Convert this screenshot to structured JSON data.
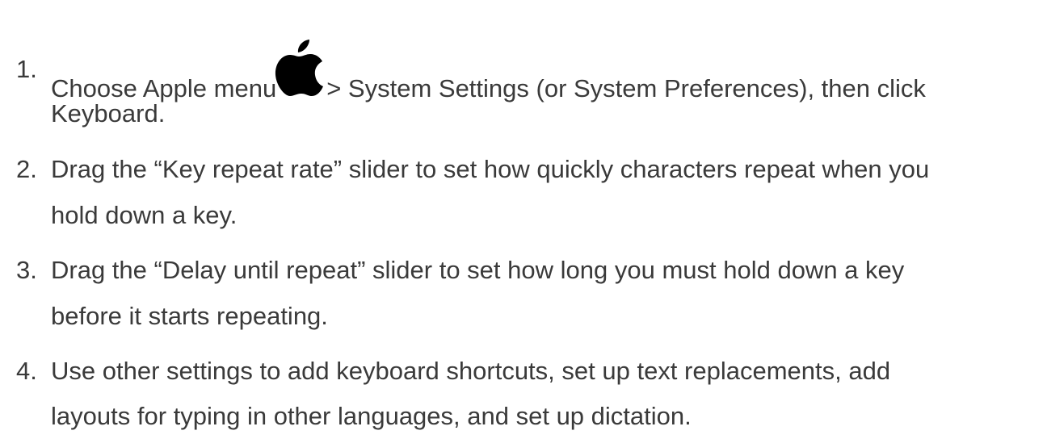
{
  "steps": [
    {
      "number": "1.",
      "lines": [
        {
          "before_icon": "Choose Apple menu",
          "after_icon": "> System Settings (or System Preferences), then click"
        },
        {
          "text": "Keyboard."
        }
      ],
      "icon": "apple-logo-icon"
    },
    {
      "number": "2.",
      "lines": [
        {
          "text": "Drag the “Key repeat rate” slider to set how quickly characters repeat when you"
        },
        {
          "text": "hold down a key."
        }
      ]
    },
    {
      "number": "3.",
      "lines": [
        {
          "text": "Drag the “Delay until repeat” slider to set how long you must hold down a key"
        },
        {
          "text": "before it starts repeating."
        }
      ]
    },
    {
      "number": "4.",
      "lines": [
        {
          "text": "Use other settings to add keyboard shortcuts, set up text replacements, add"
        },
        {
          "text": "layouts for typing in other languages, and set up dictation."
        }
      ]
    }
  ],
  "colors": {
    "text": "#3a3a3a",
    "icon": "#000000",
    "background": "#ffffff"
  }
}
